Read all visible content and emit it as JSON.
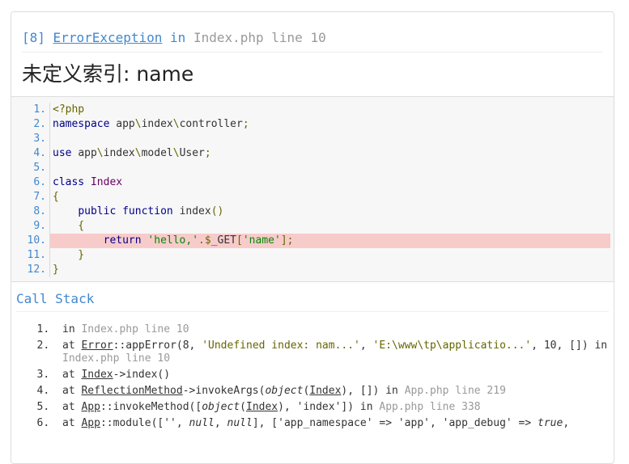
{
  "exception": {
    "code": "[8]",
    "class": "ErrorException",
    "in_word": "in",
    "location": "Index.php line 10",
    "message": "未定义索引: name"
  },
  "source": {
    "highlight_line": 10,
    "lines": [
      {
        "n": "1.",
        "t": "<?php"
      },
      {
        "n": "2.",
        "t": "namespace app\\index\\controller;"
      },
      {
        "n": "3.",
        "t": ""
      },
      {
        "n": "4.",
        "t": "use app\\index\\model\\User;"
      },
      {
        "n": "5.",
        "t": ""
      },
      {
        "n": "6.",
        "t": "class Index"
      },
      {
        "n": "7.",
        "t": "{"
      },
      {
        "n": "8.",
        "t": "    public function index()"
      },
      {
        "n": "9.",
        "t": "    {"
      },
      {
        "n": "10.",
        "t": "        return 'hello,'.$_GET['name'];"
      },
      {
        "n": "11.",
        "t": "    }"
      },
      {
        "n": "12.",
        "t": "}"
      }
    ]
  },
  "call_stack": {
    "title": "Call Stack",
    "items": [
      {
        "text": "in Index.php line 10"
      },
      {
        "text": "at Error::appError(8, 'Undefined index: nam...', 'E:\\www\\tp\\applicatio...', 10, []) in Index.php line 10"
      },
      {
        "text": "at Index->index()"
      },
      {
        "text": "at ReflectionMethod->invokeArgs(object(Index), []) in App.php line 219"
      },
      {
        "text": "at App::invokeMethod([object(Index), 'index']) in App.php line 338"
      },
      {
        "text": "at App::module(['', null, null], ['app_namespace' => 'app', 'app_debug' => true,"
      }
    ]
  }
}
